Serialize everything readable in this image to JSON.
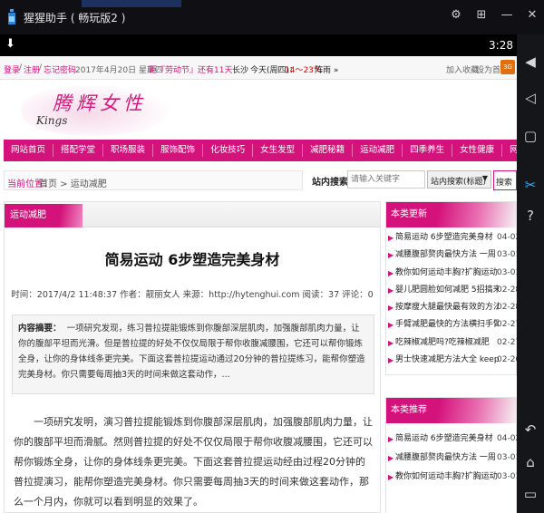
{
  "emulator": {
    "title": "猩猩助手 ( 畅玩版2 )",
    "clock": "3:28"
  },
  "top_bar": {
    "login": "登录",
    "register": "注册",
    "forgot": "忘记密码",
    "date": "2017年4月20日 星期四",
    "countdown": "距『劳动节』还有11天",
    "weather_city": "长沙",
    "weather_today": "今天(周四)：",
    "weather_temp": "14～23℃",
    "weather_cond": "阵雨 »",
    "add_favorite": "加入收藏",
    "set_home": "设为首页"
  },
  "logo": {
    "text": "腾辉女性",
    "signature": "Kings"
  },
  "nav": [
    "网站首页",
    "搭配学堂",
    "职场服装",
    "服饰配饰",
    "化妆技巧",
    "女生发型",
    "减肥秘籍",
    "运动减肥",
    "四季养生",
    "女性健康",
    "网购技巧"
  ],
  "breadcrumb": {
    "label": "当前位置：",
    "path": "首页 > 运动减肥"
  },
  "search": {
    "label": "站内搜索",
    "placeholder": "请输入关键字",
    "select_value": "站内搜索(标题)",
    "button": "搜索"
  },
  "article": {
    "section": "运动减肥",
    "title": "简易运动 6步塑造完美身材",
    "meta": "时间：2017/4/2 11:48:37  作者：靓丽女人  来源：http://hytenghui.com  阅读：37  评论：0",
    "summary_label": "内容摘要：",
    "summary": "一项研究发现，练习普拉提能锻炼到你腹部深层肌肉，加强腹部肌肉力量，让你的腹部平坦而光滑。但是普拉提的好处不仅仅局限于帮你收腹减腰围，它还可以帮你锻炼全身，让你的身体线条更完美。下面这套普拉提运动通过20分钟的普拉提练习，能帮你塑造完美身材。你只需要每周抽3天的时间来做这套动作，...",
    "body": "一项研究发明，演习普拉提能锻炼到你腹部深层肌肉，加强腹部肌肉力量，让你的腹部平坦而滑腻。然则普拉提的好处不仅仅局限于帮你收腹减腰围，它还可以帮你锻炼全身，让你的身体线条更完美。下面这套普拉提运动经由过程20分钟的普拉提演习，能帮你塑造完美身材。你只需要每周抽3天的时间来做这套动作，那么一个月内，你就可以看到明显的效果了。"
  },
  "sidebar": {
    "latest": {
      "title": "本类更新",
      "items": [
        {
          "text": "简易运动 6步塑造完美身材",
          "date": "04-02"
        },
        {
          "text": "减腰腹部赘肉最快方法 一周",
          "date": "03-01"
        },
        {
          "text": "教你如何运动丰胸?扩胸运动",
          "date": "03-01"
        },
        {
          "text": "婴儿肥圆脸如何减肥 5招搞来",
          "date": "02-28"
        },
        {
          "text": "按摩瘦大腿最快最有效的方法",
          "date": "02-28"
        },
        {
          "text": "手臂减肥最快的方法横扫手臂",
          "date": "02-27"
        },
        {
          "text": "吃辣椒减肥吗?吃辣椒减肥",
          "date": "02-27"
        },
        {
          "text": "男士快速减肥方法大全 keep",
          "date": "02-26"
        }
      ]
    },
    "recommend": {
      "title": "本类推荐",
      "items": [
        {
          "text": "简易运动 6步塑造完美身材",
          "date": "04-02"
        },
        {
          "text": "减腰腹部赘肉最快方法 一周",
          "date": "03-01"
        },
        {
          "text": "教你如何运动丰胸?扩胸运动",
          "date": "03-01"
        }
      ]
    }
  },
  "icons": {
    "emulator_logo": "bottle-icon",
    "download": "download-icon",
    "side_toolbar": [
      "volume-up-icon",
      "volume-down-icon",
      "shake-icon",
      "screenshot-scissors-icon",
      "help-icon",
      "back-icon",
      "home-icon",
      "recent-apps-icon"
    ]
  },
  "colors": {
    "accent": "#d4127b",
    "emulator_bg": "#0f0f14"
  }
}
